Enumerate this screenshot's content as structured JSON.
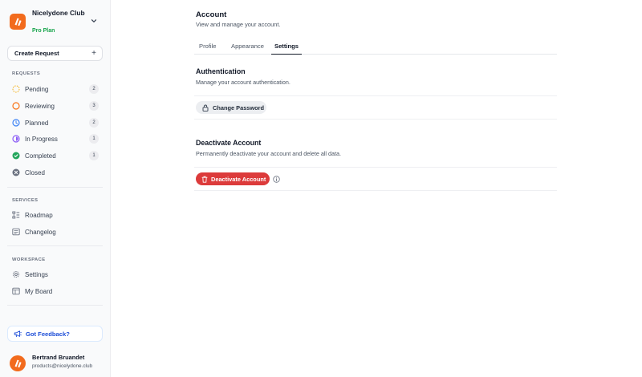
{
  "workspace": {
    "name": "Nicelydone Club",
    "plan": "Pro Plan"
  },
  "sidebar": {
    "create_label": "Create Request",
    "requests_heading": "REQUESTS",
    "requests": [
      {
        "label": "Pending",
        "count": "2"
      },
      {
        "label": "Reviewing",
        "count": "3"
      },
      {
        "label": "Planned",
        "count": "2"
      },
      {
        "label": "In Progress",
        "count": "1"
      },
      {
        "label": "Completed",
        "count": "1"
      },
      {
        "label": "Closed"
      }
    ],
    "services_heading": "SERVICES",
    "services": [
      {
        "label": "Roadmap"
      },
      {
        "label": "Changelog"
      }
    ],
    "workspace_heading": "WORKSPACE",
    "workspace_items": [
      {
        "label": "Settings"
      },
      {
        "label": "My Board"
      }
    ],
    "feedback_label": "Got Feedback?"
  },
  "user": {
    "name": "Bertrand Bruandet",
    "email": "products@nicelydone.club"
  },
  "page": {
    "title": "Account",
    "subtitle": "View and manage your account.",
    "tabs": [
      {
        "label": "Profile"
      },
      {
        "label": "Appearance"
      },
      {
        "label": "Settings",
        "active": true
      }
    ]
  },
  "authentication": {
    "title": "Authentication",
    "description": "Manage your account authentication.",
    "button_label": "Change Password"
  },
  "deactivate": {
    "title": "Deactivate Account",
    "description": "Permanently deactivate your account and delete all data.",
    "button_label": "Deactivate Account"
  },
  "colors": {
    "brand": "#f26b1d",
    "plan": "#16a34a",
    "pending": "#f5b82e",
    "reviewing": "#f97316",
    "planned": "#3b82f6",
    "in_progress": "#8b5cf6",
    "completed": "#22a55b",
    "closed": "#6b7280",
    "feedback": "#1d4ed8",
    "danger": "#dc3b3b"
  },
  "icons": {
    "brand": "logo-mark",
    "workspace_switcher": "chevron-down-icon",
    "create": "plus-icon",
    "pending": "dashed-circle-icon",
    "reviewing": "circle-icon",
    "planned": "clock-icon",
    "in_progress": "half-circle-icon",
    "completed": "check-circle-icon",
    "closed": "x-circle-icon",
    "roadmap": "roadmap-icon",
    "changelog": "changelog-icon",
    "settings": "gear-icon",
    "my_board": "board-icon",
    "feedback": "megaphone-icon",
    "change_password": "lock-icon",
    "deactivate": "trash-icon",
    "info": "info-icon"
  }
}
